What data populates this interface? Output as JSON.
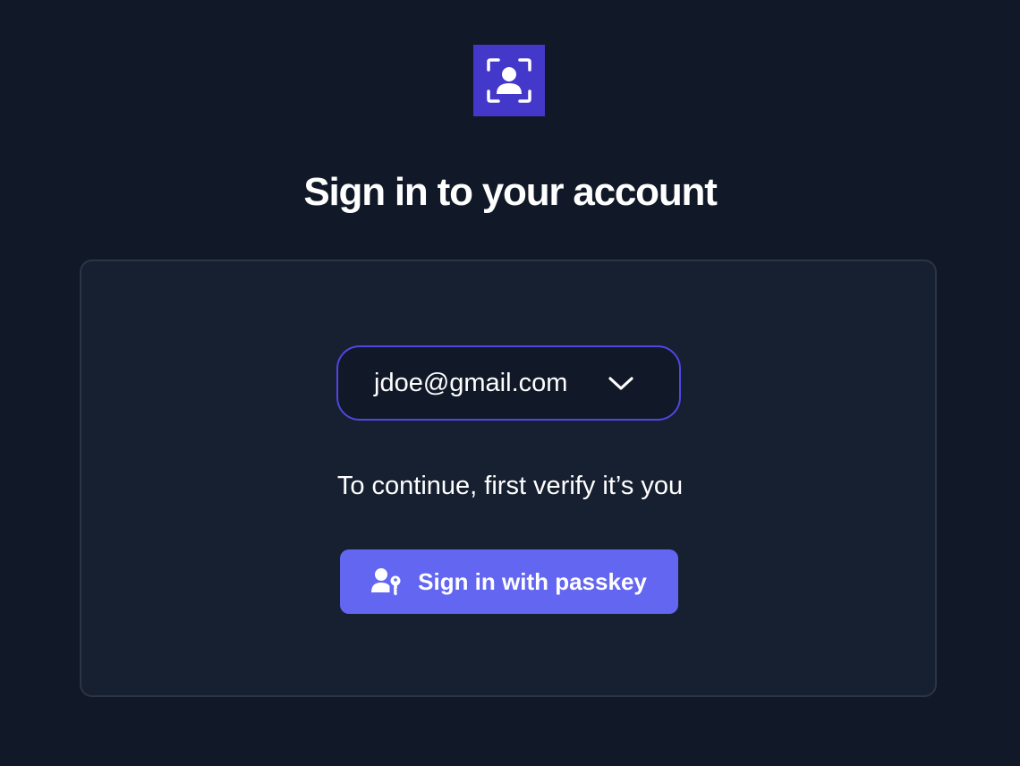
{
  "header": {
    "logo_icon": "user-focus-icon",
    "title": "Sign in to your account"
  },
  "card": {
    "account": {
      "email": "jdoe@gmail.com",
      "dropdown_icon": "chevron-down-icon"
    },
    "message": "To continue, first verify it’s you",
    "passkey_button": {
      "label": "Sign in with passkey",
      "icon": "user-key-icon"
    }
  },
  "colors": {
    "background": "#111827",
    "card_background": "#172030",
    "card_border": "#2c3544",
    "logo_background": "#4338ca",
    "select_border": "#5046e5",
    "button_background": "#6366f1",
    "text": "#ffffff"
  }
}
